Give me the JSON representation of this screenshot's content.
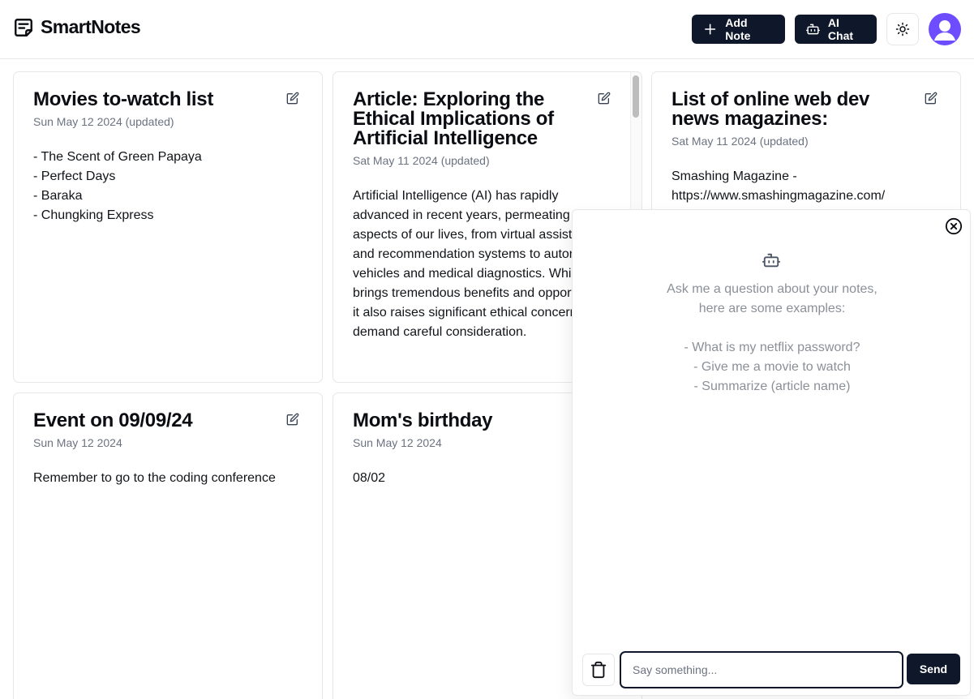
{
  "app": {
    "name": "SmartNotes"
  },
  "header": {
    "add_note_label": "Add Note",
    "ai_chat_label": "AI Chat"
  },
  "notes": [
    {
      "title": "Movies to-watch list",
      "date": "Sun May 12 2024 (updated)",
      "body": "- The Scent of Green Papaya\n- Perfect Days\n- Baraka\n- Chungking Express"
    },
    {
      "title": "Article: Exploring the Ethical Implications of Artificial Intelligence",
      "date": "Sat May 11 2024 (updated)",
      "body": "Artificial Intelligence (AI) has rapidly advanced in recent years, permeating various aspects of our lives, from virtual assistants and recommendation systems to autonomous vehicles and medical diagnostics. While AI brings tremendous benefits and opportunities, it also raises significant ethical concerns that demand careful consideration."
    },
    {
      "title": "List of online web dev news magazines:",
      "date": "Sat May 11 2024 (updated)",
      "body": "Smashing Magazine -\nhttps://www.smashingmagazine.com/"
    },
    {
      "title": "Event on 09/09/24",
      "date": "Sun May 12 2024",
      "body": "Remember to go to the coding conference"
    },
    {
      "title": "Mom's birthday",
      "date": "Sun May 12 2024",
      "body": "08/02"
    }
  ],
  "chat": {
    "intro": "Ask me a question about your notes,\nhere are some examples:",
    "examples": [
      "- What is my netflix password?",
      "- Give me a movie to watch",
      "- Summarize (article name)"
    ],
    "input_placeholder": "Say something...",
    "input_value": "",
    "send_label": "Send"
  },
  "icons": {
    "logo": "sticky-note-icon",
    "add": "plus-icon",
    "chat": "bot-icon",
    "theme": "sun-icon",
    "avatar": "user-avatar-icon",
    "edit": "edit-icon",
    "close": "close-circle-icon",
    "trash": "trash-icon"
  },
  "colors": {
    "primary": "#0f172a",
    "avatar_bg": "#6d4dff",
    "muted_text": "#6b7280",
    "border": "#e5e7eb"
  }
}
